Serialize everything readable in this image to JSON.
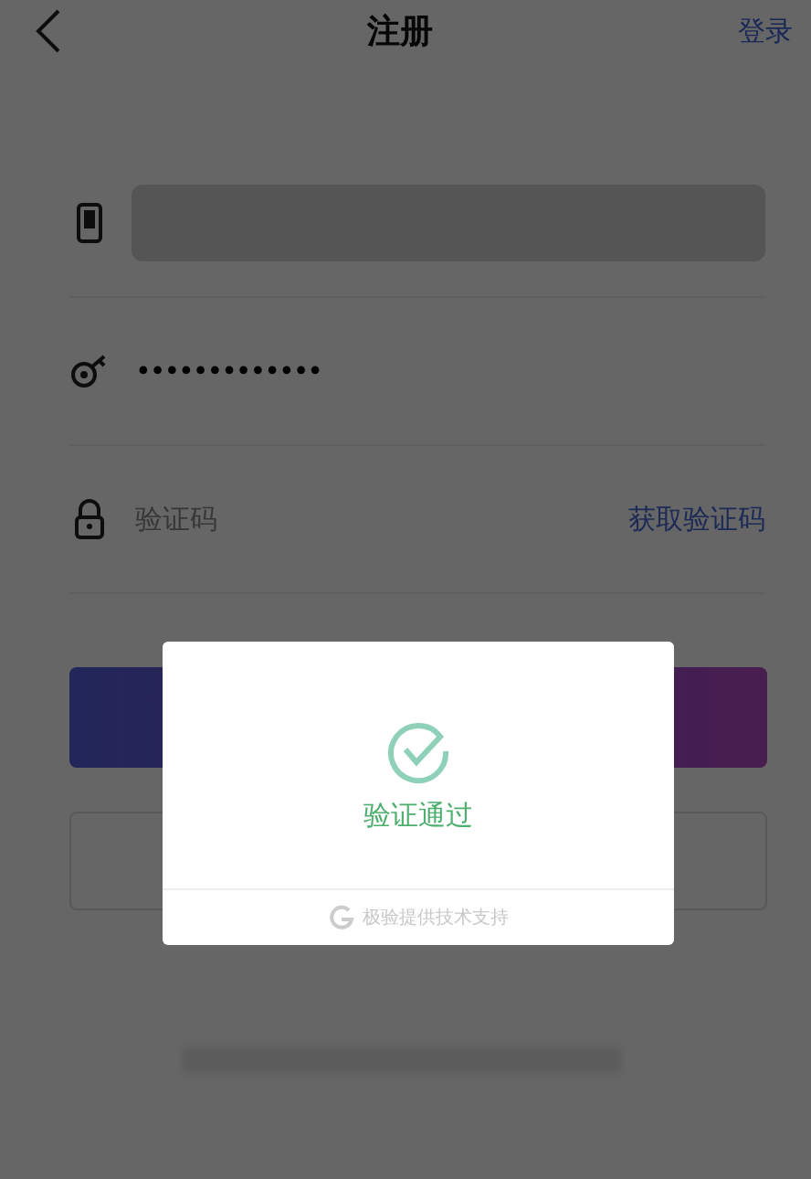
{
  "header": {
    "title": "注册",
    "login_link": "登录"
  },
  "fields": [
    {
      "kind": "phone"
    },
    {
      "kind": "password",
      "value": "•••••••••••••"
    },
    {
      "kind": "code",
      "placeholder": "验证码",
      "action": "获取验证码"
    }
  ],
  "dialog": {
    "message": "验证通过",
    "footer": "极验提供技术支持"
  }
}
